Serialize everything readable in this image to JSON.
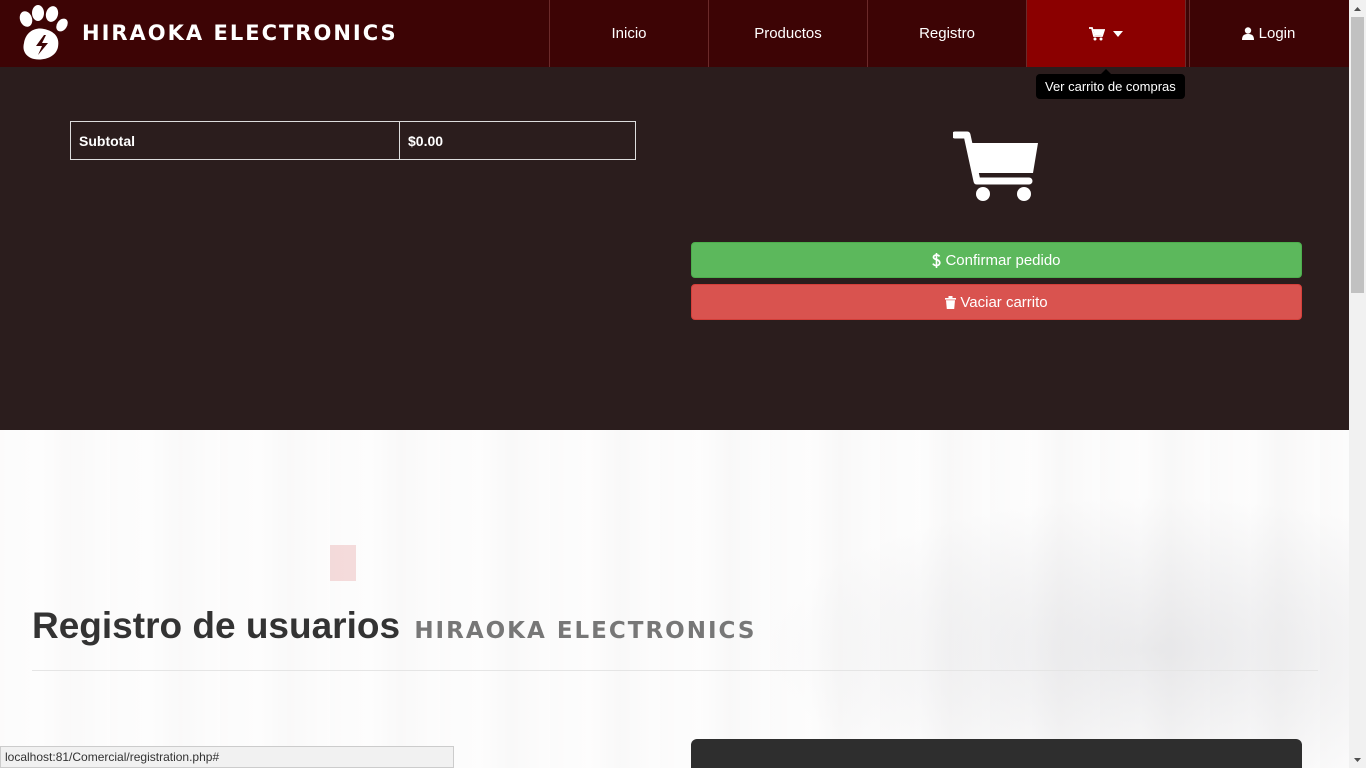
{
  "navbar": {
    "brand_name": "HIRAOKA ELECTRONICS",
    "logo_icon": "paw-lightning-icon",
    "items": [
      {
        "label": "Inicio"
      },
      {
        "label": "Productos"
      },
      {
        "label": "Registro"
      }
    ],
    "cart_icon": "shopping-cart-icon",
    "cart_caret_icon": "caret-down-icon",
    "login_icon": "user-icon",
    "login_label": "Login",
    "bg_color": "#3d0405",
    "active_color": "#8b0000"
  },
  "tooltip": {
    "text": "Ver carrito de compras"
  },
  "cart": {
    "subtotal_label": "Subtotal",
    "subtotal_value": "$0.00",
    "big_icon": "shopping-cart-icon",
    "confirm_label": "Confirmar pedido",
    "confirm_icon": "dollar-icon",
    "empty_label": "Vaciar carrito",
    "empty_icon": "trash-icon",
    "confirm_color": "#5cb85c",
    "empty_color": "#d9534f"
  },
  "registration": {
    "title": "Registro de usuarios",
    "brand": "HIRAOKA ELECTRONICS"
  },
  "status_bar": {
    "url": "localhost:81/Comercial/registration.php#"
  }
}
